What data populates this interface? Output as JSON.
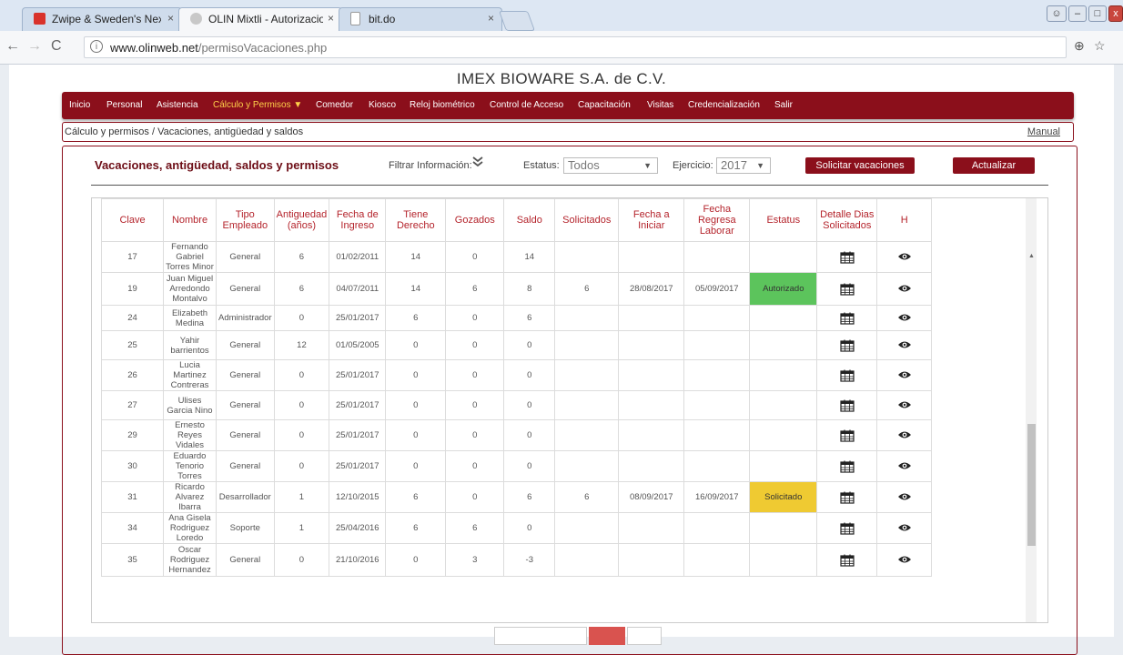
{
  "browser": {
    "tabs": [
      {
        "label": "Zwipe & Sweden's Nexus",
        "close": "×",
        "favicon_color": "#d9322b"
      },
      {
        "label": "OLIN Mixtli - Autorizacio",
        "close": "×",
        "favicon_color": "#c8c8c8"
      },
      {
        "label": "bit.do",
        "close": "×",
        "favicon_color": "#ffffff"
      }
    ],
    "url_domain": "www.olinweb.net",
    "url_path": "/permisoVacaciones.php",
    "info_icon": "i",
    "zoom_icon": "⊕",
    "star_icon": "☆"
  },
  "company": "IMEX BIOWARE S.A. de C.V.",
  "nav": {
    "items": [
      "Inicio",
      "Personal",
      "Asistencia",
      "Cálculo y Permisos",
      "Comedor",
      "Kiosco",
      "Reloj biométrico",
      "Control de Acceso",
      "Capacitación",
      "Visitas",
      "Credencialización",
      "Salir"
    ],
    "active_index": 3
  },
  "breadcrumb": "Cálculo y permisos / Vacaciones, antigüedad y saldos",
  "manual_link": "Manual",
  "panel": {
    "title": "Vacaciones, antigüedad, saldos y permisos",
    "filter_label": "Filtrar Información:",
    "status_label": "Estatus:",
    "status_value": "Todos",
    "year_label": "Ejercicio:",
    "year_value": "2017",
    "request_button": "Solicitar vacaciones",
    "update_button": "Actualizar"
  },
  "table": {
    "headers": [
      "Clave",
      "Nombre",
      "Tipo Empleado",
      "Antiguedad (años)",
      "Fecha de Ingreso",
      "Tiene Derecho",
      "Gozados",
      "Saldo",
      "Solicitados",
      "Fecha a Iniciar",
      "Fecha Regresa Laborar",
      "Estatus",
      "Detalle Dias Solicitados",
      "H"
    ],
    "rows": [
      {
        "clave": "17",
        "nombre": "Fernando Gabriel Torres Minor",
        "tipo": "General",
        "antig": "6",
        "ingreso": "01/02/2011",
        "derecho": "14",
        "gozados": "0",
        "saldo": "14",
        "solicitados": "",
        "iniciar": "",
        "regresa": "",
        "estatus": ""
      },
      {
        "clave": "19",
        "nombre": "Juan Miguel Arredondo Montalvo",
        "tipo": "General",
        "antig": "6",
        "ingreso": "04/07/2011",
        "derecho": "14",
        "gozados": "6",
        "saldo": "8",
        "solicitados": "6",
        "iniciar": "28/08/2017",
        "regresa": "05/09/2017",
        "estatus": "Autorizado"
      },
      {
        "clave": "24",
        "nombre": "Elizabeth Medina",
        "tipo": "Administrador",
        "antig": "0",
        "ingreso": "25/01/2017",
        "derecho": "6",
        "gozados": "0",
        "saldo": "6",
        "solicitados": "",
        "iniciar": "",
        "regresa": "",
        "estatus": ""
      },
      {
        "clave": "25",
        "nombre": "Yahir barrientos",
        "tipo": "General",
        "antig": "12",
        "ingreso": "01/05/2005",
        "derecho": "0",
        "gozados": "0",
        "saldo": "0",
        "solicitados": "",
        "iniciar": "",
        "regresa": "",
        "estatus": ""
      },
      {
        "clave": "26",
        "nombre": "Lucia Martinez Contreras",
        "tipo": "General",
        "antig": "0",
        "ingreso": "25/01/2017",
        "derecho": "0",
        "gozados": "0",
        "saldo": "0",
        "solicitados": "",
        "iniciar": "",
        "regresa": "",
        "estatus": ""
      },
      {
        "clave": "27",
        "nombre": "Ulises Garcia Nino",
        "tipo": "General",
        "antig": "0",
        "ingreso": "25/01/2017",
        "derecho": "0",
        "gozados": "0",
        "saldo": "0",
        "solicitados": "",
        "iniciar": "",
        "regresa": "",
        "estatus": ""
      },
      {
        "clave": "29",
        "nombre": "Ernesto Reyes Vidales",
        "tipo": "General",
        "antig": "0",
        "ingreso": "25/01/2017",
        "derecho": "0",
        "gozados": "0",
        "saldo": "0",
        "solicitados": "",
        "iniciar": "",
        "regresa": "",
        "estatus": ""
      },
      {
        "clave": "30",
        "nombre": "Eduardo Tenorio Torres",
        "tipo": "General",
        "antig": "0",
        "ingreso": "25/01/2017",
        "derecho": "0",
        "gozados": "0",
        "saldo": "0",
        "solicitados": "",
        "iniciar": "",
        "regresa": "",
        "estatus": ""
      },
      {
        "clave": "31",
        "nombre": "Ricardo Alvarez Ibarra",
        "tipo": "Desarrollador",
        "antig": "1",
        "ingreso": "12/10/2015",
        "derecho": "6",
        "gozados": "0",
        "saldo": "6",
        "solicitados": "6",
        "iniciar": "08/09/2017",
        "regresa": "16/09/2017",
        "estatus": "Solicitado"
      },
      {
        "clave": "34",
        "nombre": "Ana Gisela Rodriguez Loredo",
        "tipo": "Soporte",
        "antig": "1",
        "ingreso": "25/04/2016",
        "derecho": "6",
        "gozados": "6",
        "saldo": "0",
        "solicitados": "",
        "iniciar": "",
        "regresa": "",
        "estatus": ""
      },
      {
        "clave": "35",
        "nombre": "Oscar Rodriguez Hernandez",
        "tipo": "General",
        "antig": "0",
        "ingreso": "21/10/2016",
        "derecho": "0",
        "gozados": "3",
        "saldo": "-3",
        "solicitados": "",
        "iniciar": "",
        "regresa": "",
        "estatus": ""
      }
    ]
  },
  "colors": {
    "brand": "#8b0f1b",
    "authorized": "#5cc45c",
    "requested": "#efca32",
    "header_text": "#b4232b"
  }
}
